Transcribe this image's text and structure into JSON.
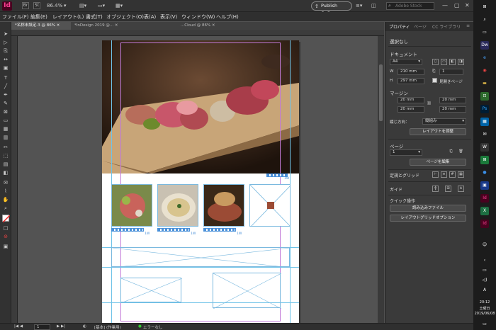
{
  "app": {
    "icon_text": "Id",
    "zoom": "86.4%",
    "publish_label": "Publish Online",
    "search_placeholder": "Adobe Stock",
    "br_label": "Br",
    "st_label": "St"
  },
  "menu": [
    "ファイル(F)",
    "編集(E)",
    "レイアウト(L)",
    "書式(T)",
    "オブジェクト(O)",
    "表(A)",
    "表示(V)",
    "ウィンドウ(W)",
    "ヘルプ(H)"
  ],
  "tabs": [
    "*名称未設定-3 @ 86%",
    "*InDesign 2019 @...",
    "...Cloud @ 86%"
  ],
  "statusbar": {
    "page": "1",
    "style": "[基本] (作業用)",
    "errors": "エラーなし"
  },
  "thumb_labels": [
    "1W",
    "1W",
    "1W",
    "1W"
  ],
  "panel": {
    "tabs": [
      "プロパティ",
      "ページ",
      "CC ライブラリ"
    ],
    "no_selection": "選択なし",
    "document_heading": "ドキュメント",
    "size_value": "A4",
    "width_value": "210 mm",
    "height_value": "297 mm",
    "pages_value": "1",
    "facing_pages": "見開きページ",
    "margin_heading": "マージン",
    "margin_top": "20 mm",
    "margin_bottom": "20 mm",
    "margin_left": "20 mm",
    "margin_right": "20 mm",
    "binding_label": "綴じ方向：",
    "binding_value": "縦組み",
    "adjust_layout": "レイアウトを調整",
    "page_heading": "ページ",
    "page_value": "1",
    "edit_page": "ページを編集",
    "grid_heading": "定規とグリッド",
    "guides_heading": "ガイド",
    "quick_heading": "クイック操作",
    "import_file": "読み込みファイル",
    "layout_grid_options": "レイアウトグリッドオプション"
  },
  "taskbar": {
    "time": "20:12",
    "day": "土曜日",
    "date": "2019/06/08"
  },
  "colors": {
    "accent": "#4a90d9",
    "indesign_pink": "#ff3f94",
    "guide": "#6fc3e8"
  }
}
